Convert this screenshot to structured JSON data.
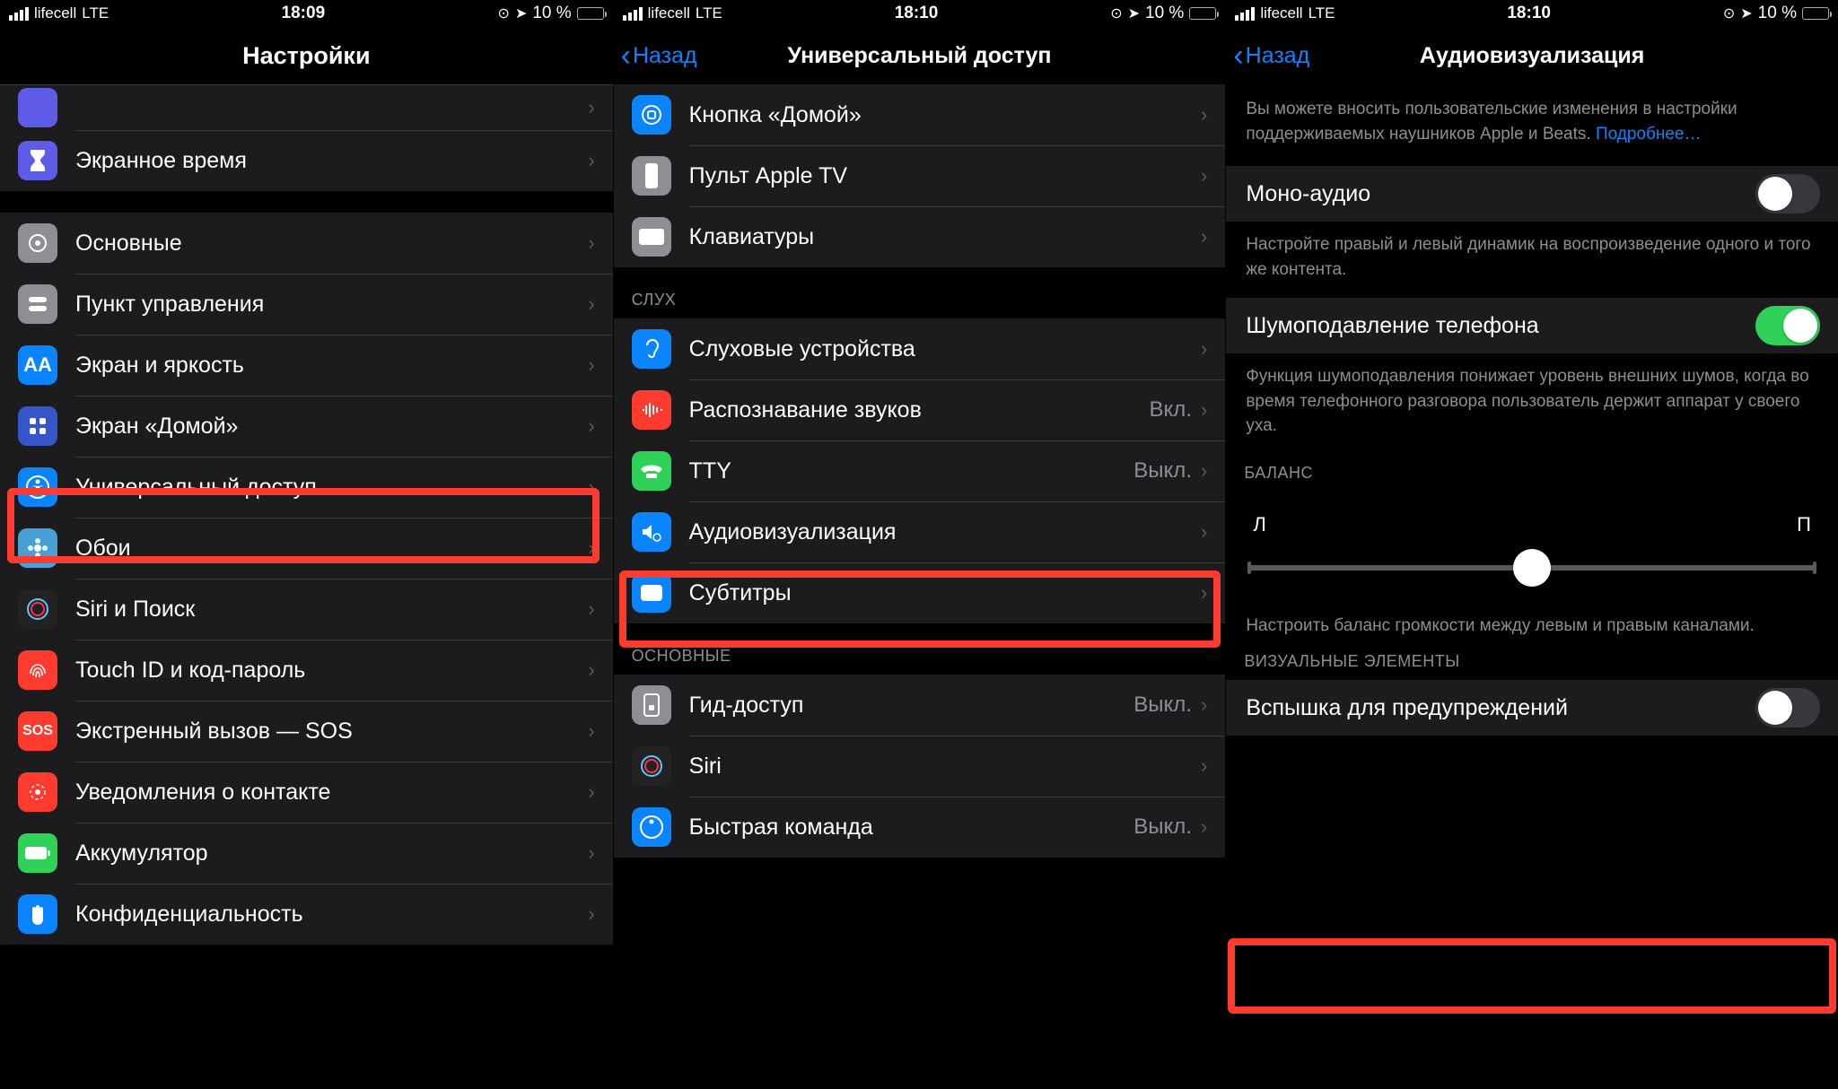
{
  "status": {
    "carrier": "lifecell",
    "network": "LTE",
    "battery_pct": "10 %"
  },
  "phone1": {
    "time": "18:09",
    "title": "Настройки",
    "rows": {
      "screen_time": "Экранное время",
      "general": "Основные",
      "control_center": "Пункт управления",
      "display": "Экран и яркость",
      "home_screen": "Экран «Домой»",
      "accessibility": "Универсальный доступ",
      "wallpaper": "Обои",
      "siri": "Siri и Поиск",
      "touchid": "Touch ID и код-пароль",
      "sos": "Экстренный вызов — SOS",
      "exposure": "Уведомления о контакте",
      "battery": "Аккумулятор",
      "privacy": "Конфиденциальность"
    }
  },
  "phone2": {
    "time": "18:10",
    "back": "Назад",
    "title": "Универсальный доступ",
    "rows": {
      "home_button": "Кнопка «Домой»",
      "apple_tv": "Пульт Apple TV",
      "keyboards": "Клавиатуры",
      "hearing_section": "Слух",
      "hearing_devices": "Слуховые устройства",
      "sound_recognition": "Распознавание звуков",
      "sound_recognition_val": "Вкл.",
      "tty": "TTY",
      "tty_val": "Выкл.",
      "audio_visual": "Аудиовизуализация",
      "subtitles": "Субтитры",
      "general_section": "Основные",
      "guided_access": "Гид-доступ",
      "guided_access_val": "Выкл.",
      "siri": "Siri",
      "shortcut": "Быстрая команда",
      "shortcut_val": "Выкл."
    }
  },
  "phone3": {
    "time": "18:10",
    "back": "Назад",
    "title": "Аудиовизуализация",
    "top_text": "Вы можете вносить пользовательские изменения в настройки поддерживаемых наушников Apple и Beats. ",
    "top_link": "Подробнее…",
    "mono_audio": "Моно-аудио",
    "mono_footer": "Настройте правый и левый динамик на воспроизведение одного и того же контента.",
    "noise_cancel": "Шумоподавление телефона",
    "noise_footer": "Функция шумоподавления понижает уровень внешних шумов, когда во время телефонного разговора пользователь держит аппарат у своего уха.",
    "balance_header": "Баланс",
    "balance_left": "Л",
    "balance_right": "П",
    "balance_footer": "Настроить баланс громкости между левым и правым каналами.",
    "visual_header": "Визуальные элементы",
    "flash_alerts": "Вспышка для предупреждений"
  },
  "colors": {
    "icon_blue": "#0a84ff",
    "icon_gray": "#8e8e93",
    "icon_green": "#30d158",
    "icon_red": "#ff3b30",
    "icon_purple": "#5e5ce6",
    "icon_orange": "#ff9500"
  }
}
